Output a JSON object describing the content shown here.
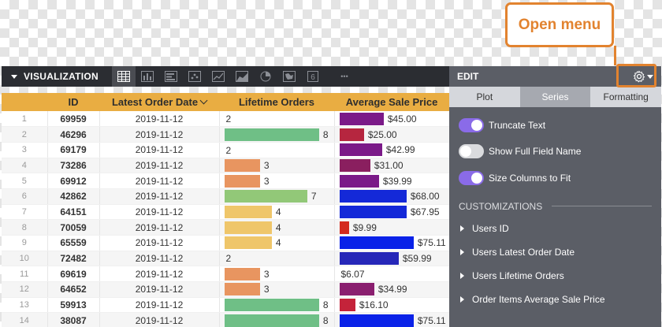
{
  "callout": {
    "label": "Open menu"
  },
  "toolbar": {
    "title": "VISUALIZATION",
    "icons": [
      "table-icon",
      "column-chart-icon",
      "bar-chart-icon",
      "scatter-icon",
      "line-icon",
      "area-icon",
      "pie-icon",
      "map-icon",
      "single-value-icon",
      "more-icon"
    ],
    "single_value_glyph": "6",
    "more_glyph": "•••"
  },
  "table": {
    "headers": {
      "num": "",
      "id": "ID",
      "date": "Latest Order Date",
      "orders": "Lifetime Orders",
      "price": "Average Sale Price"
    },
    "orders_max": 8,
    "price_max": 80,
    "rows": [
      {
        "num": "1",
        "id": "69959",
        "date": "2019-11-12",
        "orders": 2,
        "orders_label": "2",
        "orders_color": "",
        "price": 45.0,
        "price_label": "$45.00",
        "price_color": "#7b1a88"
      },
      {
        "num": "2",
        "id": "46296",
        "date": "2019-11-12",
        "orders": 8,
        "orders_label": "8",
        "orders_color": "#6fbf86",
        "price": 25.0,
        "price_label": "$25.00",
        "price_color": "#b6263f"
      },
      {
        "num": "3",
        "id": "69179",
        "date": "2019-11-12",
        "orders": 2,
        "orders_label": "2",
        "orders_color": "",
        "price": 42.99,
        "price_label": "$42.99",
        "price_color": "#7b1a88"
      },
      {
        "num": "4",
        "id": "73286",
        "date": "2019-11-12",
        "orders": 3,
        "orders_label": "3",
        "orders_color": "#e89560",
        "price": 31.0,
        "price_label": "$31.00",
        "price_color": "#8a1f5f"
      },
      {
        "num": "5",
        "id": "69912",
        "date": "2019-11-12",
        "orders": 3,
        "orders_label": "3",
        "orders_color": "#e89560",
        "price": 39.99,
        "price_label": "$39.99",
        "price_color": "#7b1a88"
      },
      {
        "num": "6",
        "id": "42862",
        "date": "2019-11-12",
        "orders": 7,
        "orders_label": "7",
        "orders_color": "#92c878",
        "price": 68.0,
        "price_label": "$68.00",
        "price_color": "#1429d8"
      },
      {
        "num": "7",
        "id": "64151",
        "date": "2019-11-12",
        "orders": 4,
        "orders_label": "4",
        "orders_color": "#efc66a",
        "price": 67.95,
        "price_label": "$67.95",
        "price_color": "#1429d8"
      },
      {
        "num": "8",
        "id": "70059",
        "date": "2019-11-12",
        "orders": 4,
        "orders_label": "4",
        "orders_color": "#efc66a",
        "price": 9.99,
        "price_label": "$9.99",
        "price_color": "#d42a1e"
      },
      {
        "num": "9",
        "id": "65559",
        "date": "2019-11-12",
        "orders": 4,
        "orders_label": "4",
        "orders_color": "#efc66a",
        "price": 75.11,
        "price_label": "$75.11",
        "price_color": "#0a22e8"
      },
      {
        "num": "10",
        "id": "72482",
        "date": "2019-11-12",
        "orders": 2,
        "orders_label": "2",
        "orders_color": "",
        "price": 59.99,
        "price_label": "$59.99",
        "price_color": "#2627b8"
      },
      {
        "num": "11",
        "id": "69619",
        "date": "2019-11-12",
        "orders": 3,
        "orders_label": "3",
        "orders_color": "#e89560",
        "price": 6.07,
        "price_label": "$6.07",
        "price_color": ""
      },
      {
        "num": "12",
        "id": "64652",
        "date": "2019-11-12",
        "orders": 3,
        "orders_label": "3",
        "orders_color": "#e89560",
        "price": 34.99,
        "price_label": "$34.99",
        "price_color": "#8a1f6f"
      },
      {
        "num": "13",
        "id": "59913",
        "date": "2019-11-12",
        "orders": 8,
        "orders_label": "8",
        "orders_color": "#6fbf86",
        "price": 16.1,
        "price_label": "$16.10",
        "price_color": "#c4233a"
      },
      {
        "num": "14",
        "id": "38087",
        "date": "2019-11-12",
        "orders": 8,
        "orders_label": "8",
        "orders_color": "#6fbf86",
        "price": 75.11,
        "price_label": "$75.11",
        "price_color": "#0a22e8"
      }
    ]
  },
  "edit": {
    "title": "EDIT",
    "tabs": [
      "Plot",
      "Series",
      "Formatting"
    ],
    "active_tab": "Series",
    "toggles": [
      {
        "label": "Truncate Text",
        "on": true
      },
      {
        "label": "Show Full Field Name",
        "on": false
      },
      {
        "label": "Size Columns to Fit",
        "on": true
      }
    ],
    "customizations_label": "CUSTOMIZATIONS",
    "customizations": [
      "Users ID",
      "Users Latest Order Date",
      "Users Lifetime Orders",
      "Order Items Average Sale Price"
    ]
  }
}
